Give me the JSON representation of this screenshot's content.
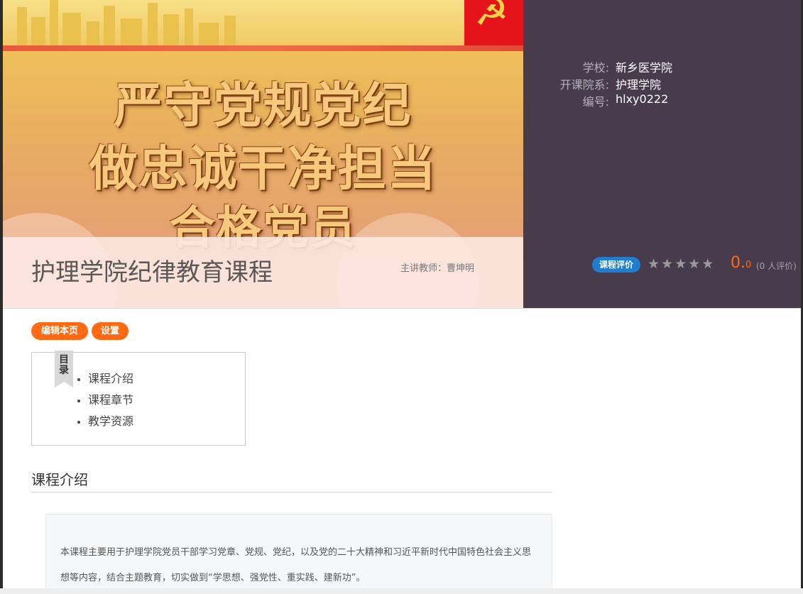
{
  "banner": {
    "slogan_line1": "严守党规党纪",
    "slogan_line2": "做忠诚干净担当",
    "slogan_line3": "合格党员",
    "course_title": "护理学院纪律教育课程",
    "teacher_label": "主讲教师：",
    "teacher_name": "曹坤明"
  },
  "info": {
    "school_label": "学校:",
    "school_value": "新乡医学院",
    "dept_label": "开课院系:",
    "dept_value": "护理学院",
    "code_label": "编号:",
    "code_value": "hlxy0222",
    "eval_label": "课程评价",
    "score_int": "0.",
    "score_dec": "0",
    "raters": "(0 人评价)",
    "rating_stars": 0
  },
  "actions": {
    "edit_label": "编辑本页",
    "settings_label": "设置"
  },
  "toc": {
    "tag_line1": "目",
    "tag_line2": "录",
    "items": [
      "课程介绍",
      "课程章节",
      "教学资源"
    ]
  },
  "section": {
    "title": "课程介绍",
    "intro_text": "本课程主要用于护理学院党员干部学习党章、党规、党纪，以及党的二十大精神和习近平新时代中国特色社会主义思想等内容，结合主题教育，切实做到“学思想、强党性、重实践、建新功”。"
  },
  "colors": {
    "accent_orange": "#ff6a13",
    "info_panel_bg": "#473b4c",
    "badge_blue": "#1f7ecf"
  }
}
